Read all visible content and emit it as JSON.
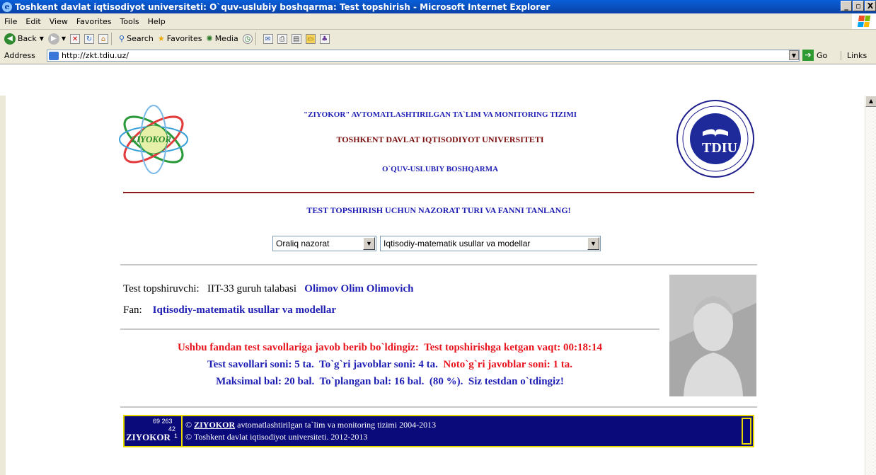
{
  "window": {
    "title": "Toshkent davlat iqtisodiyot universiteti: O`quv-uslubiy boshqarma: Test topshirish - Microsoft Internet Explorer",
    "controls": [
      "_",
      "▫",
      "X"
    ]
  },
  "menu": [
    "File",
    "Edit",
    "View",
    "Favorites",
    "Tools",
    "Help"
  ],
  "toolbar": {
    "back": "Back",
    "search": "Search",
    "favorites": "Favorites",
    "media": "Media"
  },
  "address": {
    "label": "Address",
    "url": "http://zkt.tdiu.uz/",
    "go": "Go",
    "links": "Links"
  },
  "header": {
    "line1": "\"ZIYOKOR\" AVTOMATLASHTIRILGAN TA`LIM VA MONITORING TIZIMI",
    "line2": "TOSHKENT DAVLAT IQTISODIYOT UNIVERSITETI",
    "line3": "O`QUV-USLUBIY BOSHQARMA",
    "logo_left_text": "ZIYOKOR",
    "logo_right_text": "TDIU"
  },
  "instruction": "TEST TOPSHIRISH UCHUN NAZORAT TURI VA FANNI TANLANG!",
  "selects": {
    "control_type": "Oraliq nazorat",
    "subject": "Iqtisodiy-matematik usullar va modellar"
  },
  "student": {
    "label": "Test topshiruvchi:",
    "group": "IIT-33 guruh talabasi",
    "name": "Olimov Olim Olimovich",
    "fan_label": "Fan:",
    "fan": "Iqtisodiy-matematik usullar va modellar"
  },
  "result": {
    "line1_a": "Ushbu fandan test savollariga javob berib bo`ldingiz:",
    "line1_b": "Test topshirishga ketgan vaqt: 00:18:14",
    "line2_a": "Test savollari soni: 5 ta.",
    "line2_b": "To`g`ri javoblar soni: 4 ta.",
    "line2_c": "Noto`g`ri javoblar soni: 1 ta.",
    "line3_a": "Maksimal bal: 20 bal.",
    "line3_b": "To`plangan bal: 16 bal.",
    "line3_c": "(80 %).",
    "line3_d": "Siz testdan o`tdingiz!"
  },
  "footer": {
    "brand": "ZIYOKOR",
    "counter1": "69 263",
    "counter2": "42",
    "counter3": "1",
    "copyright1_symbol": "©",
    "copyright1_link": "ZIYOKOR",
    "copyright1_rest": "avtomatlashtirilgan ta`lim va monitoring tizimi   2004-2013",
    "copyright2": "© Toshkent davlat iqtisodiyot universiteti.   2012-2013"
  },
  "colors": {
    "title_blue": "#1e1eb4",
    "title_red": "#7a1010",
    "alert_red": "#e8141e",
    "footer_bg": "#0a0a7a",
    "footer_border": "#e8d800"
  }
}
